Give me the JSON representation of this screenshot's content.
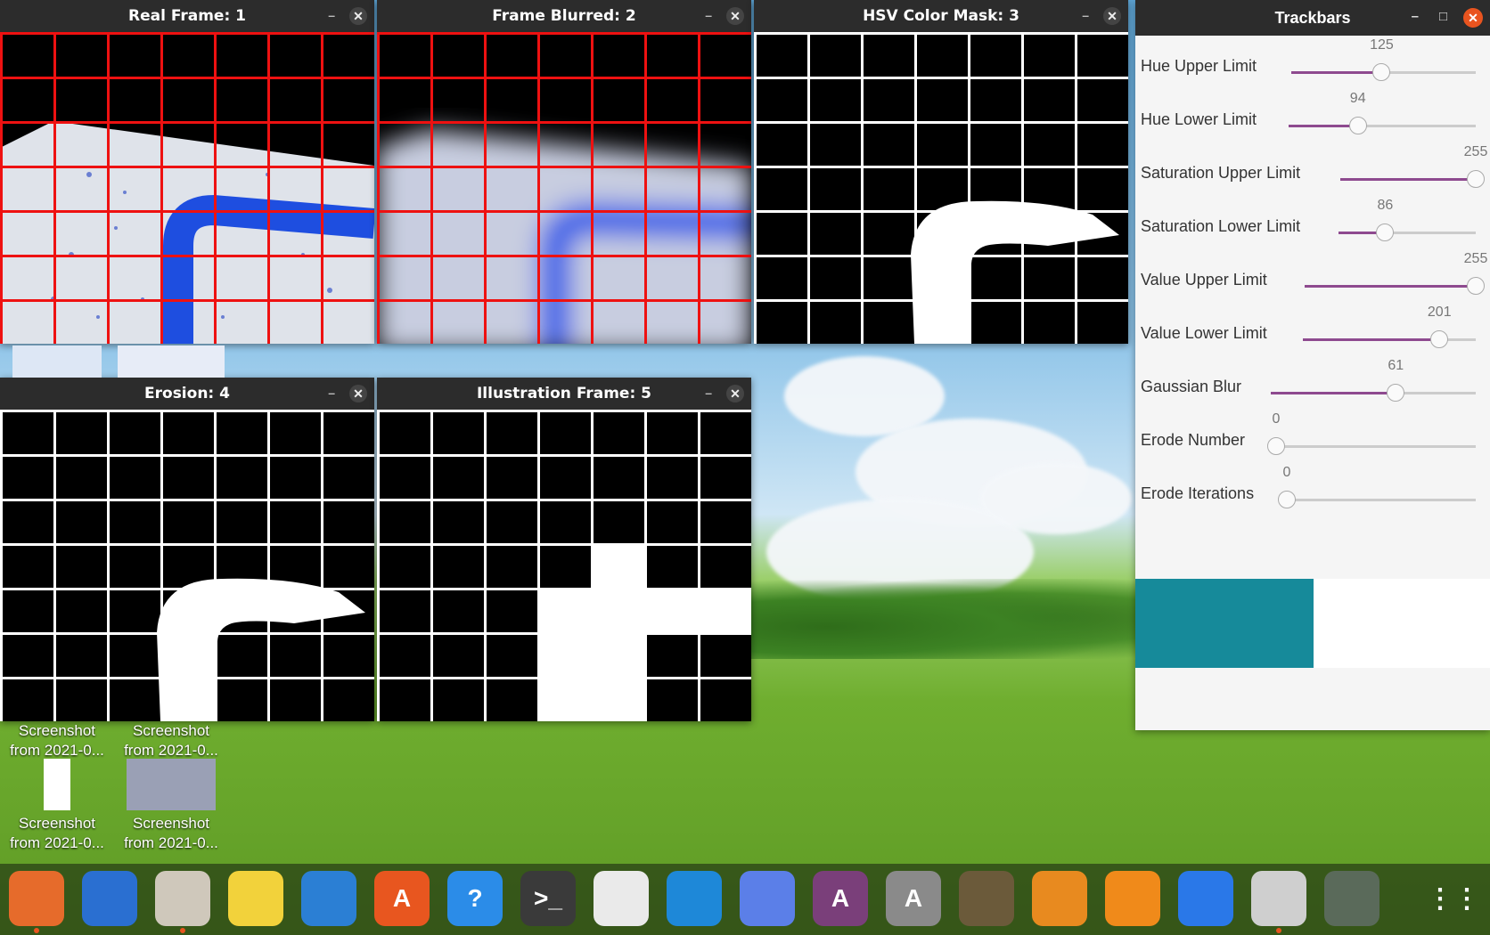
{
  "windows": {
    "real": {
      "title": "Real Frame: 1"
    },
    "blur": {
      "title": "Frame Blurred: 2"
    },
    "mask": {
      "title": "HSV  Color Mask: 3"
    },
    "erosion": {
      "title": "Erosion: 4"
    },
    "illustration": {
      "title": "Illustration Frame: 5"
    }
  },
  "trackbars": {
    "title": "Trackbars",
    "swatch_color": "#168a9a",
    "items": [
      {
        "label": "Hue Upper Limit",
        "value": "125",
        "fraction": 0.49
      },
      {
        "label": "Hue Lower Limit",
        "value": "94",
        "fraction": 0.37
      },
      {
        "label": "Saturation Upper Limit",
        "value": "255",
        "fraction": 1.0
      },
      {
        "label": "Saturation Lower Limit",
        "value": "86",
        "fraction": 0.34
      },
      {
        "label": "Value Upper Limit",
        "value": "255",
        "fraction": 1.0
      },
      {
        "label": "Value Lower Limit",
        "value": "201",
        "fraction": 0.79
      },
      {
        "label": "Gaussian Blur",
        "value": "61",
        "fraction": 0.61
      },
      {
        "label": "Erode Number",
        "value": "0",
        "fraction": 0.0
      },
      {
        "label": "Erode Iterations",
        "value": "0",
        "fraction": 0.0
      }
    ]
  },
  "desktop": {
    "icons": [
      {
        "line1": "Screenshot",
        "line2": "from 2021-0..."
      },
      {
        "line1": "Screenshot",
        "line2": "from 2021-0..."
      },
      {
        "line1": "Screenshot",
        "line2": "from 2021-0..."
      },
      {
        "line1": "Screenshot",
        "line2": "from 2021-0..."
      }
    ]
  },
  "dock": {
    "items": [
      {
        "name": "firefox-icon",
        "color": "#e66b2b"
      },
      {
        "name": "thunderbird-icon",
        "color": "#2a6fd1"
      },
      {
        "name": "files-icon",
        "color": "#cfc8bb"
      },
      {
        "name": "rhythmbox-icon",
        "color": "#f2d23b"
      },
      {
        "name": "writer-icon",
        "color": "#2b7fd4"
      },
      {
        "name": "software-icon",
        "color": "#e8561f"
      },
      {
        "name": "help-icon",
        "color": "#2b8ce8"
      },
      {
        "name": "terminal-icon",
        "color": "#3a3a3a"
      },
      {
        "name": "text-editor-icon",
        "color": "#eaeaea"
      },
      {
        "name": "vscode-icon",
        "color": "#1e88d8"
      },
      {
        "name": "screenshot-icon",
        "color": "#5b7fe8"
      },
      {
        "name": "app-a-icon",
        "color": "#7a3f7a"
      },
      {
        "name": "app-b-icon",
        "color": "#8a8a8a"
      },
      {
        "name": "gimp-icon",
        "color": "#6b5a3a"
      },
      {
        "name": "box-icon",
        "color": "#e88a1f"
      },
      {
        "name": "blender-icon",
        "color": "#f08a1a"
      },
      {
        "name": "chromium-icon",
        "color": "#2a78e8"
      },
      {
        "name": "image-viewer-icon",
        "color": "#cfcfcf"
      },
      {
        "name": "active-window-icon",
        "color": "#5a6a5a"
      },
      {
        "name": "app-grid-icon",
        "color": "#ffffff"
      }
    ]
  }
}
